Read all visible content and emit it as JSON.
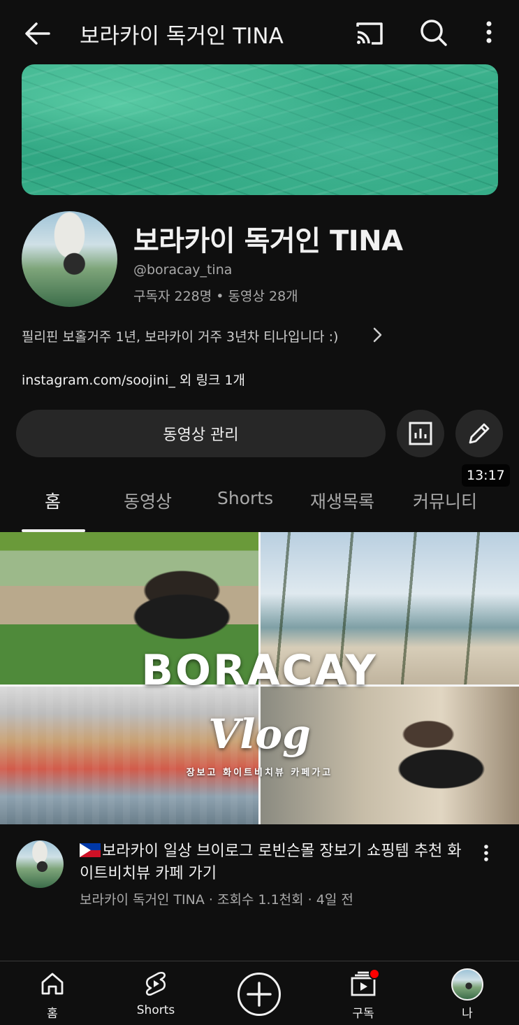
{
  "topbar": {
    "title": "보라카이 독거인 TINA",
    "icons": [
      "back-arrow-icon",
      "cast-icon",
      "search-icon",
      "more-vertical-icon"
    ]
  },
  "channel": {
    "name": "보라카이 독거인 TINA",
    "handle": "@boracay_tina",
    "stats": "구독자 228명 • 동영상 28개",
    "description": "필리핀 보홀거주 1년, 보라카이 거주 3년차 티나입니다 :)",
    "link": "instagram.com/soojini_ 외 링크 1개"
  },
  "actions": {
    "manage_label": "동영상 관리",
    "icons": [
      "analytics-icon",
      "edit-pencil-icon"
    ]
  },
  "tabs": [
    {
      "label": "홈",
      "active": true
    },
    {
      "label": "동영상",
      "active": false
    },
    {
      "label": "Shorts",
      "active": false
    },
    {
      "label": "재생목록",
      "active": false
    },
    {
      "label": "커뮤니티",
      "active": false
    }
  ],
  "video": {
    "thumbnail_title": "BORACAY",
    "thumbnail_subtitle": "Vlog",
    "thumbnail_caption": "장보고 화이트비치뷰 카페가고",
    "duration": "13:17",
    "title": "보라카이 일상 브이로그 로빈슨몰 장보기 쇼핑템 추천 화이트비치뷰 카페 가기",
    "meta": "보라카이 독거인 TINA · 조회수 1.1천회 · 4일 전"
  },
  "navbar": {
    "items": [
      {
        "label": "홈",
        "icon": "home-icon"
      },
      {
        "label": "Shorts",
        "icon": "shorts-icon"
      },
      {
        "label": "",
        "icon": "create-plus-icon"
      },
      {
        "label": "구독",
        "icon": "subscriptions-icon"
      },
      {
        "label": "나",
        "icon": "avatar-icon"
      }
    ],
    "notification_color": "#ff0000"
  }
}
